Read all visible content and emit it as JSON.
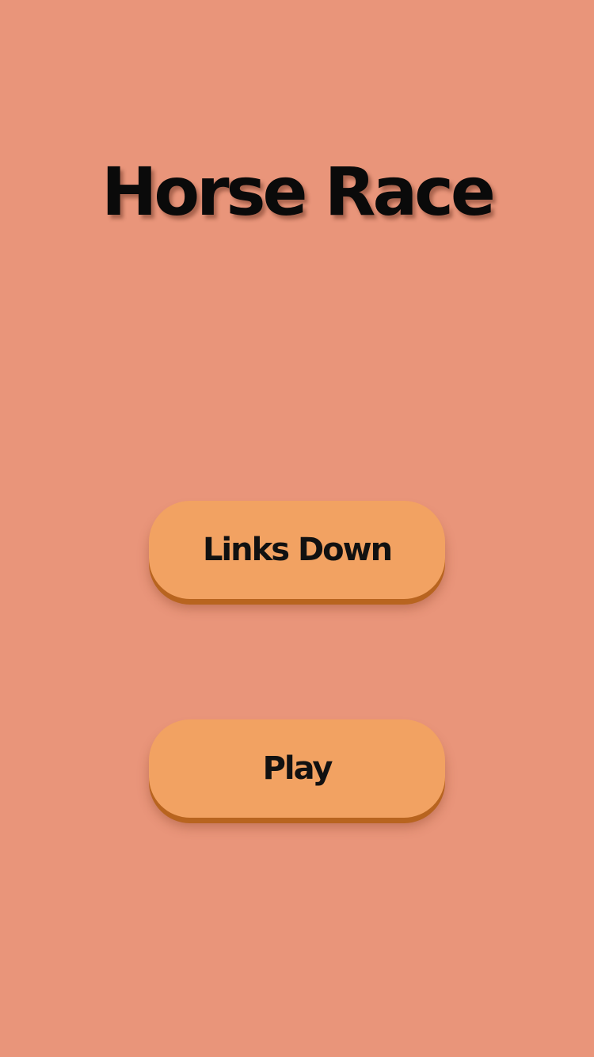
{
  "app": {
    "title": "Horse Race"
  },
  "menu": {
    "links_down_label": "Links Down",
    "play_label": "Play"
  },
  "colors": {
    "background": "#E9957A",
    "button_fill": "#F2A262",
    "button_shadow": "#B8641F",
    "text": "#0a0a0a"
  }
}
